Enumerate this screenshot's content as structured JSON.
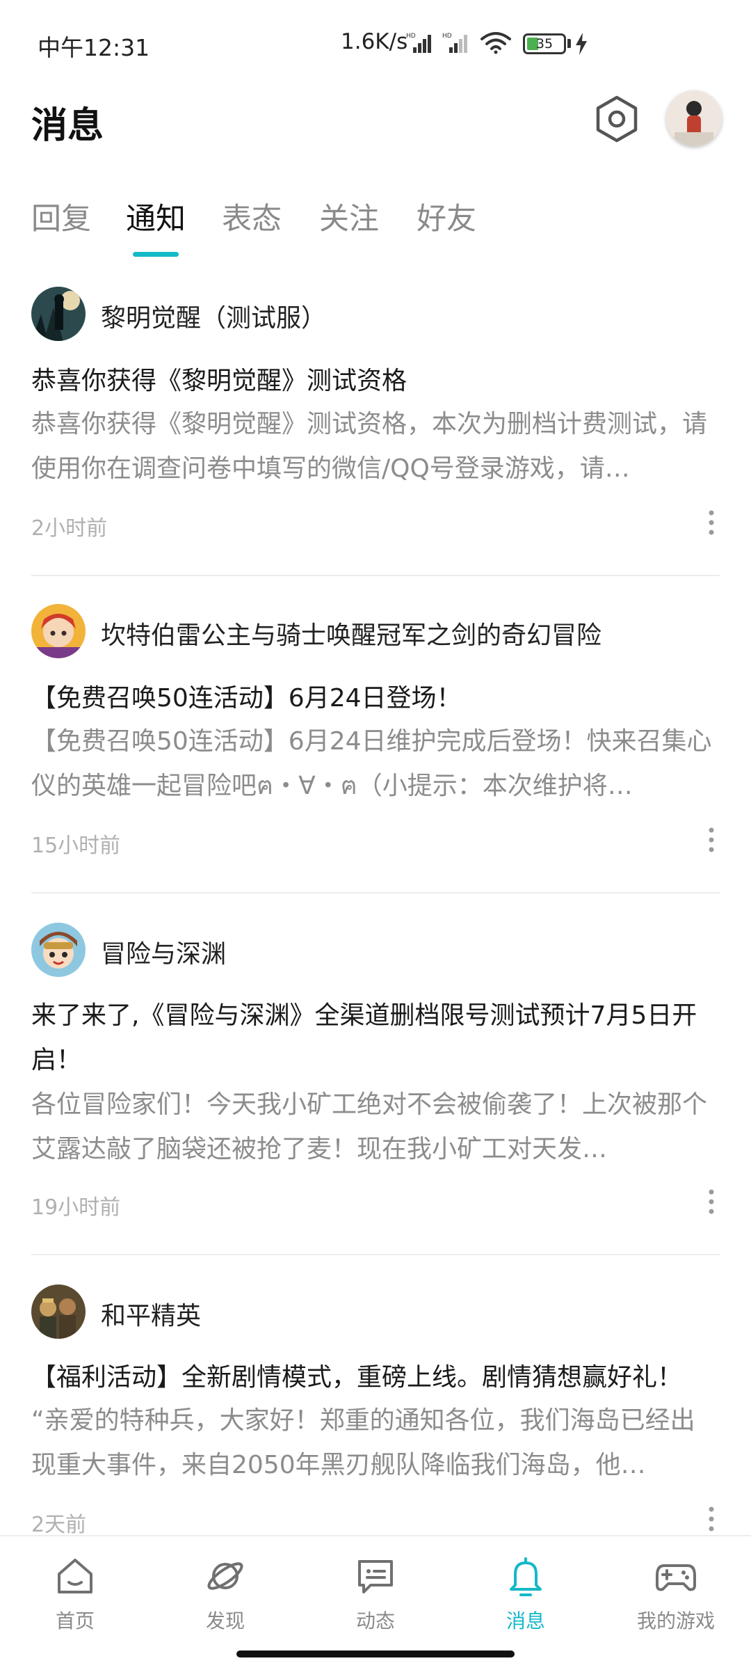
{
  "status_bar": {
    "time": "中午12:31",
    "network_speed": "1.6K/s",
    "battery_level": "35",
    "icons": [
      "hd-signal-icon",
      "hd-signal-icon",
      "wifi-icon",
      "battery-icon",
      "charging-bolt-icon"
    ]
  },
  "header": {
    "title": "消息",
    "settings_icon": "hexagon-settings-icon",
    "avatar_icon": "user-avatar"
  },
  "tabs": [
    {
      "label": "回复",
      "active": false
    },
    {
      "label": "通知",
      "active": true
    },
    {
      "label": "表态",
      "active": false
    },
    {
      "label": "关注",
      "active": false
    },
    {
      "label": "好友",
      "active": false
    }
  ],
  "notifications": [
    {
      "name": "黎明觉醒（测试服）",
      "title": "恭喜你获得《黎明觉醒》测试资格",
      "body": "恭喜你获得《黎明觉醒》测试资格，本次为删档计费测试，请使用你在调查问卷中填写的微信/QQ号登录游戏，请…",
      "time": "2小时前"
    },
    {
      "name": "坎特伯雷公主与骑士唤醒冠军之剑的奇幻冒险",
      "title": "【免费召唤50连活动】6月24日登场！",
      "body": "【免费召唤50连活动】6月24日维护完成后登场！快来召集心仪的英雄一起冒险吧ฅ・∀・ฅ（小提示：本次维护将…",
      "time": "15小时前"
    },
    {
      "name": "冒险与深渊",
      "title": "来了来了,《冒险与深渊》全渠道删档限号测试预计7月5日开启！",
      "body": "各位冒险家们！今天我小矿工绝对不会被偷袭了！上次被那个艾露达敲了脑袋还被抢了麦！现在我小矿工对天发…",
      "time": "19小时前"
    },
    {
      "name": "和平精英",
      "title": "【福利活动】全新剧情模式，重磅上线。剧情猜想赢好礼！",
      "body": "“亲爱的特种兵，大家好！郑重的通知各位，我们海岛已经出现重大事件，来自2050年黑刃舰队降临我们海岛，他…",
      "time": "2天前"
    }
  ],
  "bottom_nav": [
    {
      "label": "首页",
      "icon": "home-icon",
      "active": false
    },
    {
      "label": "发现",
      "icon": "planet-icon",
      "active": false
    },
    {
      "label": "动态",
      "icon": "chat-bubble-icon",
      "active": false
    },
    {
      "label": "消息",
      "icon": "bell-icon",
      "active": true
    },
    {
      "label": "我的游戏",
      "icon": "gamepad-icon",
      "active": false
    }
  ],
  "colors": {
    "accent": "#14b9c8",
    "text_primary": "#1a1a1a",
    "text_secondary": "#8c8c8c",
    "text_muted": "#b0b0b0"
  }
}
